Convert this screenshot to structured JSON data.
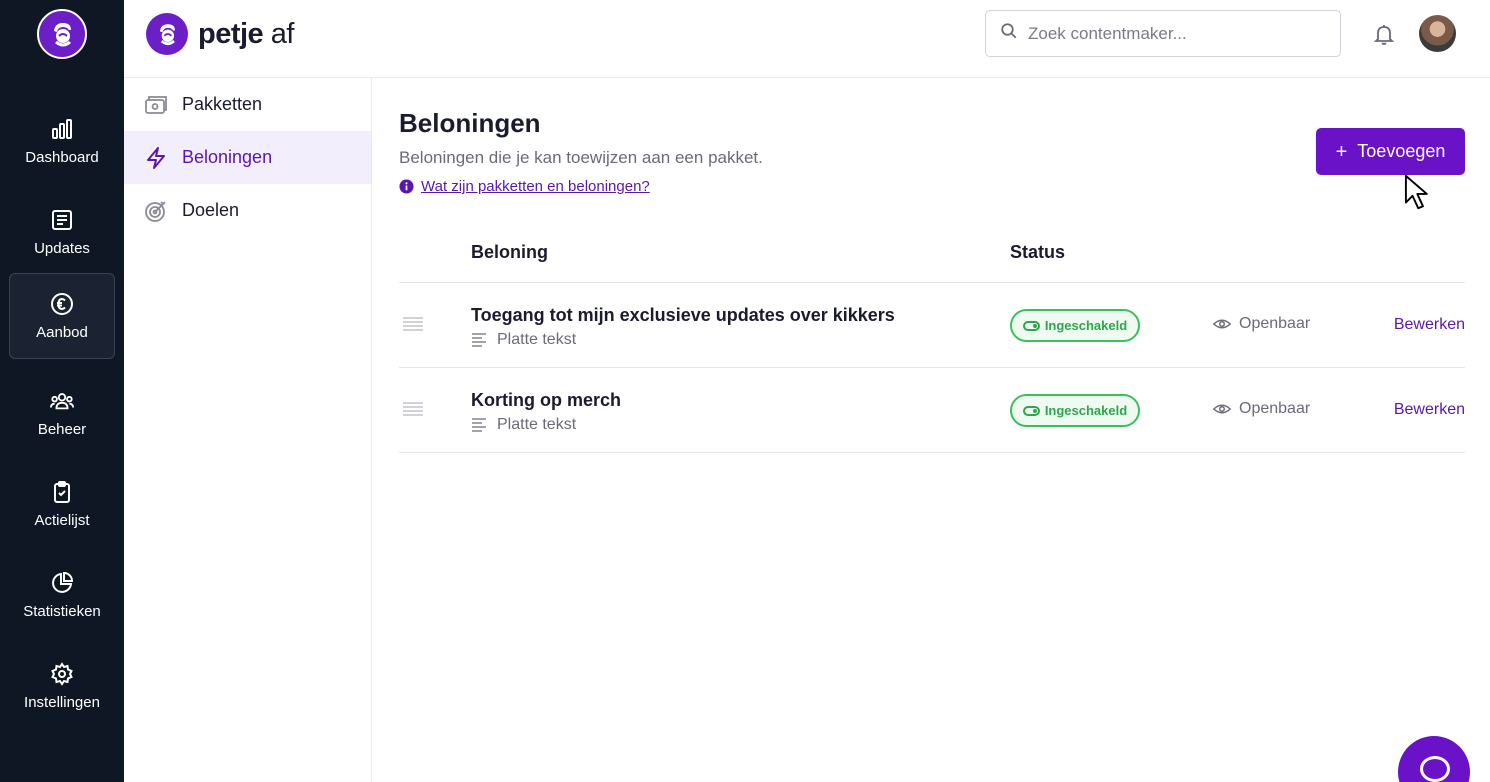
{
  "brand": {
    "name_bold": "petje",
    "name_light": "af"
  },
  "colors": {
    "accent": "#6a12c8",
    "rail_bg": "#0f1624",
    "status_green": "#2ea64d"
  },
  "rail": {
    "items": [
      {
        "label": "Dashboard",
        "icon": "bar-chart-icon"
      },
      {
        "label": "Updates",
        "icon": "newspaper-icon"
      },
      {
        "label": "Aanbod",
        "icon": "euro-icon",
        "active": true
      },
      {
        "label": "Beheer",
        "icon": "users-icon"
      },
      {
        "label": "Actielijst",
        "icon": "clipboard-check-icon"
      },
      {
        "label": "Statistieken",
        "icon": "pie-chart-icon"
      },
      {
        "label": "Instellingen",
        "icon": "gear-icon"
      }
    ]
  },
  "header": {
    "search_placeholder": "Zoek contentmaker..."
  },
  "subnav": {
    "items": [
      {
        "label": "Pakketten",
        "icon": "package-icon"
      },
      {
        "label": "Beloningen",
        "icon": "lightning-icon",
        "active": true
      },
      {
        "label": "Doelen",
        "icon": "target-icon"
      }
    ]
  },
  "main": {
    "title": "Beloningen",
    "subtitle": "Beloningen die je kan toewijzen aan een pakket.",
    "help_link": "Wat zijn pakketten en beloningen?",
    "add_button": "Toevoegen",
    "table": {
      "columns": {
        "reward": "Beloning",
        "status": "Status"
      },
      "rows": [
        {
          "title": "Toegang tot mijn exclusieve updates over kikkers",
          "type": "Platte tekst",
          "status": "Ingeschakeld",
          "visibility": "Openbaar",
          "action": "Bewerken"
        },
        {
          "title": "Korting op merch",
          "type": "Platte tekst",
          "status": "Ingeschakeld",
          "visibility": "Openbaar",
          "action": "Bewerken"
        }
      ]
    }
  }
}
